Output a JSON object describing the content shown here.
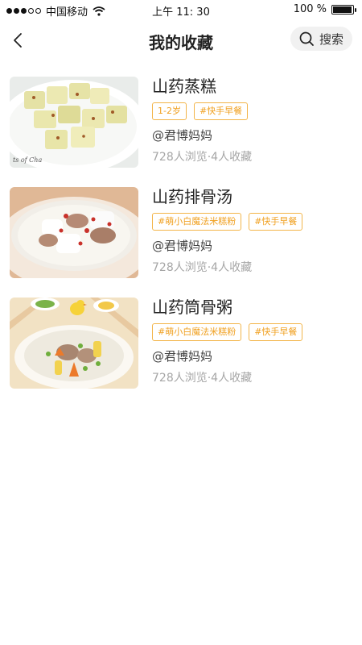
{
  "status_bar": {
    "carrier": "中国移动",
    "time": "上午 11: 30",
    "battery_text": "100 %",
    "battery_level": 1.0
  },
  "header": {
    "back_icon": "chevron-left-icon",
    "title": "我的收藏",
    "search_label": "搜索",
    "search_icon": "search-icon"
  },
  "favorites": [
    {
      "name": "山药蒸糕",
      "tags": [
        "1-2岁",
        "#快手早餐"
      ],
      "author": "@君博妈妈",
      "stats": "728人浏览·4人收藏"
    },
    {
      "name": "山药排骨汤",
      "tags": [
        "#萌小白魔法米糕粉",
        "#快手早餐"
      ],
      "author": "@君博妈妈",
      "stats": "728人浏览·4人收藏"
    },
    {
      "name": "山药筒骨粥",
      "tags": [
        "#萌小白魔法米糕粉",
        "#快手早餐"
      ],
      "author": "@君博妈妈",
      "stats": "728人浏览·4人收藏"
    }
  ],
  "colors": {
    "accent": "#f0a020",
    "text_primary": "#222222",
    "text_muted": "#a6a6a6",
    "search_bg": "#f1f1f1"
  }
}
